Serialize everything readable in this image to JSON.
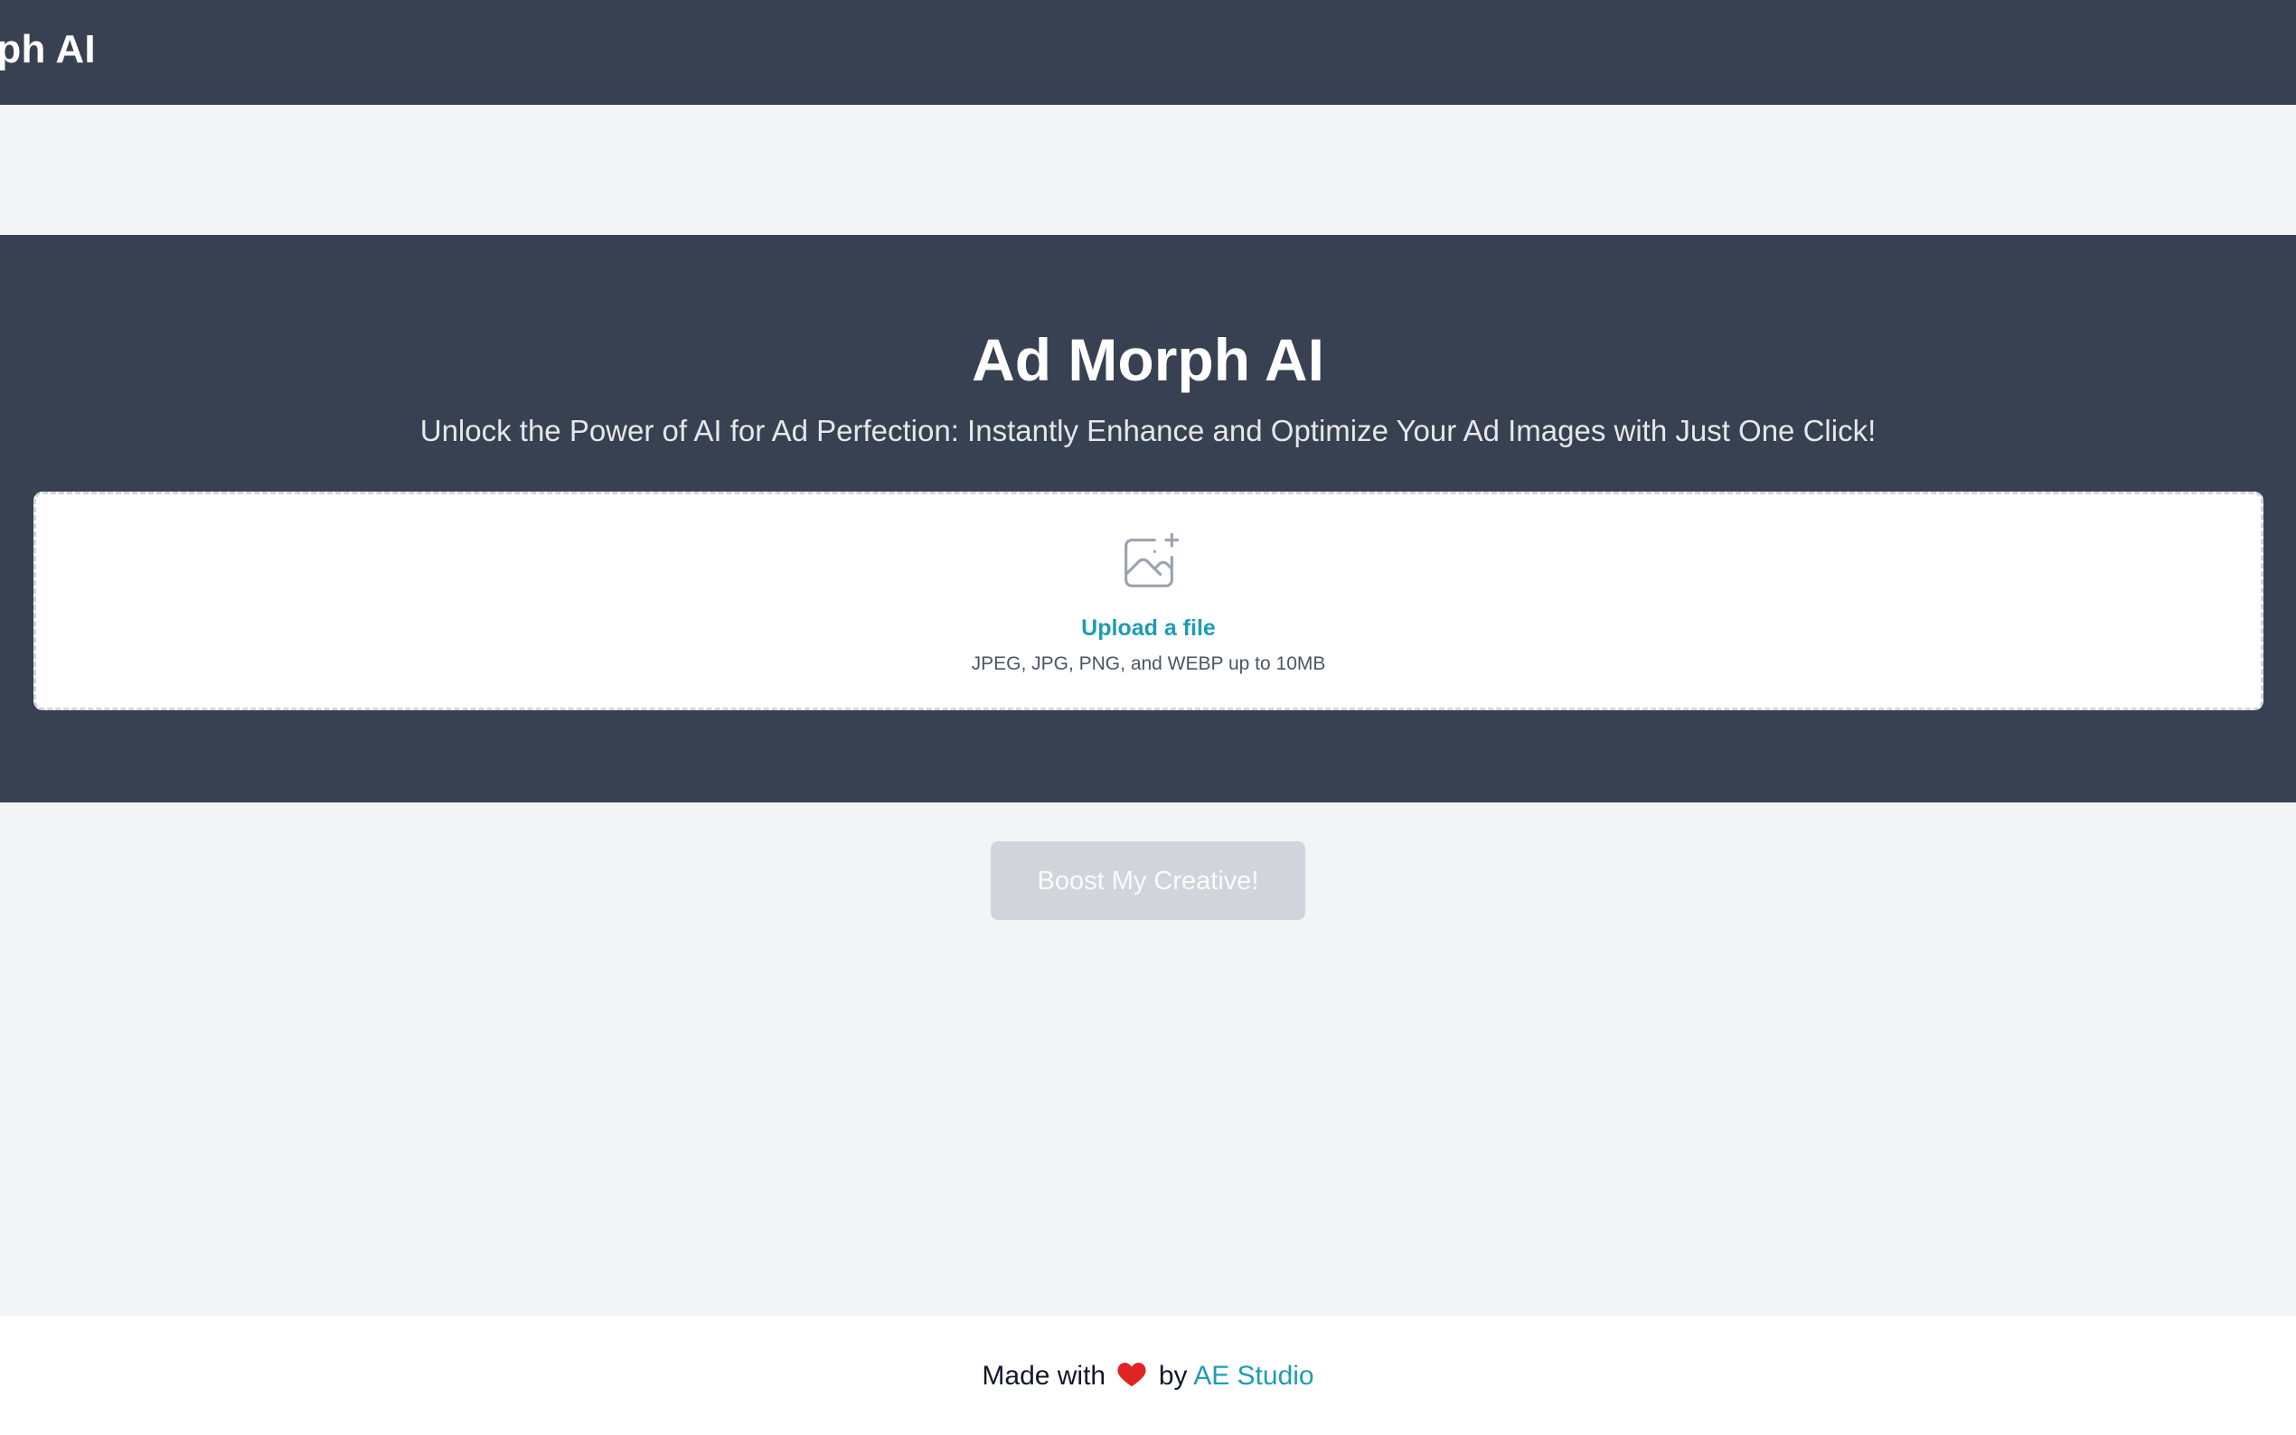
{
  "header": {
    "brand": "orph AI"
  },
  "hero": {
    "title": "Ad Morph AI",
    "subtitle": "Unlock the Power of AI for Ad Perfection: Instantly Enhance and Optimize Your Ad Images with Just One Click!"
  },
  "upload": {
    "icon": "image-add-icon",
    "link_label": "Upload a file",
    "hint": "JPEG, JPG, PNG, and WEBP up to 10MB"
  },
  "action": {
    "boost_label": "Boost My Creative!",
    "enabled": false
  },
  "footer": {
    "prefix": "Made with",
    "heart_icon": "heart-icon",
    "by": "by",
    "studio": "AE Studio"
  },
  "colors": {
    "header_bg": "#374151",
    "page_bg": "#f3f4f6",
    "accent": "#1f9bb5",
    "button_disabled": "#d1d5db",
    "heart": "#e02424"
  }
}
